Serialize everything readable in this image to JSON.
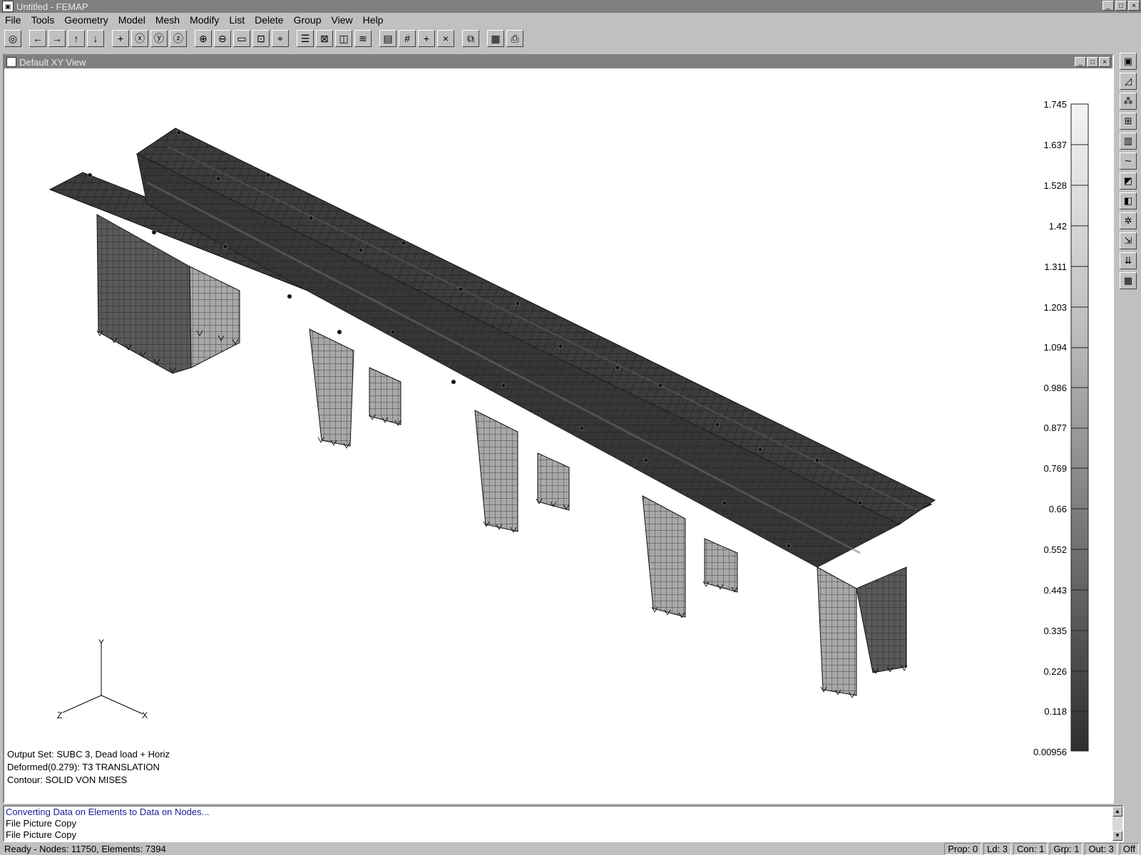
{
  "window": {
    "title": "Untitled - FEMAP",
    "controls": [
      "_",
      "□",
      "×"
    ]
  },
  "menu": [
    "File",
    "Tools",
    "Geometry",
    "Model",
    "Mesh",
    "Modify",
    "List",
    "Delete",
    "Group",
    "View",
    "Help"
  ],
  "toolbar": [
    "view-icon",
    "arrow-left-icon",
    "arrow-right-icon",
    "arrow-up-icon",
    "arrow-down-icon",
    "plus-icon",
    "rotate-x-icon",
    "rotate-y-icon",
    "rotate-z-icon",
    "zoom-in-icon",
    "zoom-out-icon",
    "zoom-box-icon",
    "autoscale-icon",
    "center-icon",
    "list-icon",
    "box-icon",
    "cube-icon",
    "layers-icon",
    "window-icon",
    "grid-icon",
    "cross-icon",
    "x-icon",
    "copy-window-icon",
    "clipboard-icon",
    "print-icon"
  ],
  "view": {
    "title": "Default XY View",
    "controls": [
      "_",
      "□",
      "×"
    ]
  },
  "legend": {
    "labels": [
      "1.745",
      "1.637",
      "1.528",
      "1.42",
      "1.311",
      "1.203",
      "1.094",
      "0.986",
      "0.877",
      "0.769",
      "0.66",
      "0.552",
      "0.443",
      "0.335",
      "0.226",
      "0.118",
      "0.00956"
    ]
  },
  "axes": {
    "y": "Y",
    "z": "Z",
    "x": "X"
  },
  "info": {
    "output_set": "Output Set: SUBC 3, Dead load + Horiz",
    "deformed": "Deformed(0.279): T3 TRANSLATION",
    "contour": "Contour: SOLID VON MISES"
  },
  "messages": [
    "Converting Data on Elements to Data on Nodes...",
    "File Picture Copy",
    "File Picture Copy"
  ],
  "status": {
    "text": "Ready - Nodes: 11750,  Elements: 7394",
    "cells": [
      "Prop: 0",
      "Ld: 3",
      "Con: 1",
      "Grp: 1",
      "Out: 3",
      "Off"
    ]
  },
  "sidebar": [
    "save-icon",
    "mesh-tool-icon",
    "node-tool-icon",
    "element-tool-icon",
    "block-tool-icon",
    "curve-tool-icon",
    "surface-tool-icon",
    "solid-tool-icon",
    "constraint-tool-icon",
    "load-tool-icon",
    "load-set-icon",
    "group-tool-icon"
  ],
  "colors": {
    "titlebar": "#808080",
    "chrome": "#c0c0c0",
    "deck": "#3a3a3a",
    "pier": "#9a9a9a"
  }
}
